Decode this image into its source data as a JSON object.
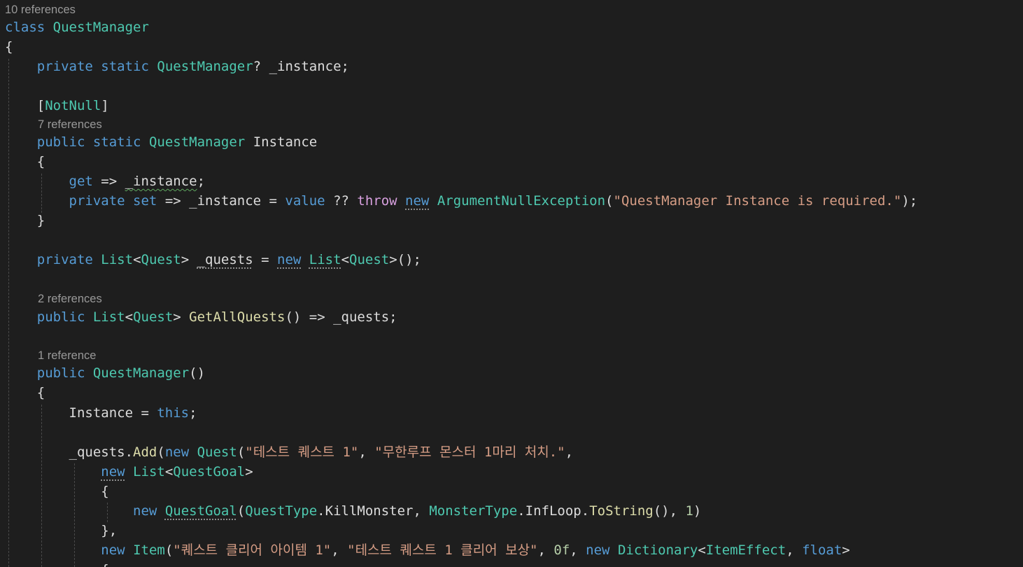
{
  "code_lens": {
    "class_refs": "10 references",
    "instance_refs": "7 references",
    "getallquests_refs": "2 references",
    "ctor_refs": "1 reference"
  },
  "tokens": {
    "class": "class",
    "private": "private",
    "public": "public",
    "static": "static",
    "get": "get",
    "set": "set",
    "value": "value",
    "throw": "throw",
    "new": "new",
    "this": "this",
    "float": "float",
    "QuestManager": "QuestManager",
    "NotNull": "NotNull",
    "Instance": "Instance",
    "_instance": "_instance",
    "_quests": "_quests",
    "List": "List",
    "Quest": "Quest",
    "QuestGoal": "QuestGoal",
    "QuestType": "QuestType",
    "KillMonster": "KillMonster",
    "MonsterType": "MonsterType",
    "InfLoop": "InfLoop",
    "ToString": "ToString",
    "Item": "Item",
    "Dictionary": "Dictionary",
    "ItemEffect": "ItemEffect",
    "ArgumentNullException": "ArgumentNullException",
    "GetAllQuests": "GetAllQuests",
    "Add": "Add",
    "num_1": "1",
    "num_0f": "0f"
  },
  "strings": {
    "exception_message": "\"QuestManager Instance is required.\"",
    "quest1_name": "\"테스트 퀘스트 1\"",
    "quest1_desc": "\"무한루프 몬스터 1마리 처치.\"",
    "item1_name": "\"퀘스트 클리어 아이템 1\"",
    "item1_desc": "\"테스트 퀘스트 1 클리어 보상\""
  },
  "colors": {
    "background": "#1e1e1e",
    "keyword": "#569cd6",
    "control_keyword": "#d8a0df",
    "type": "#4ec9b0",
    "method": "#dcdcaa",
    "string": "#d69d85",
    "number": "#b5cea8",
    "identifier": "#dcdcdc",
    "code_lens": "#999999"
  }
}
